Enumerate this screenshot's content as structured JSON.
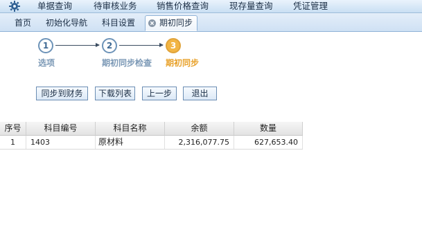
{
  "menu": {
    "items": [
      "单据查询",
      "待审核业务",
      "销售价格查询",
      "现存量查询",
      "凭证管理"
    ]
  },
  "tabs": [
    {
      "label": "首页"
    },
    {
      "label": "初始化导航"
    },
    {
      "label": "科目设置"
    },
    {
      "label": "期初同步",
      "active": true
    }
  ],
  "wizard": {
    "steps": [
      {
        "number": "1",
        "label": "选项"
      },
      {
        "number": "2",
        "label": "期初同步检查"
      },
      {
        "number": "3",
        "label": "期初同步",
        "current": true
      }
    ],
    "buttons": {
      "sync": "同步到财务",
      "download": "下载列表",
      "prev": "上一步",
      "exit": "退出"
    }
  },
  "grid": {
    "columns": [
      "序号",
      "科目编号",
      "科目名称",
      "余额",
      "数量"
    ],
    "rows": [
      [
        "1",
        "1403",
        "原材料",
        "2,316,077.75",
        "627,653.40"
      ]
    ]
  },
  "colors": {
    "accent": "#e8a12a",
    "step_done": "#6d93b8",
    "menu_bg": "#c9dff3"
  }
}
